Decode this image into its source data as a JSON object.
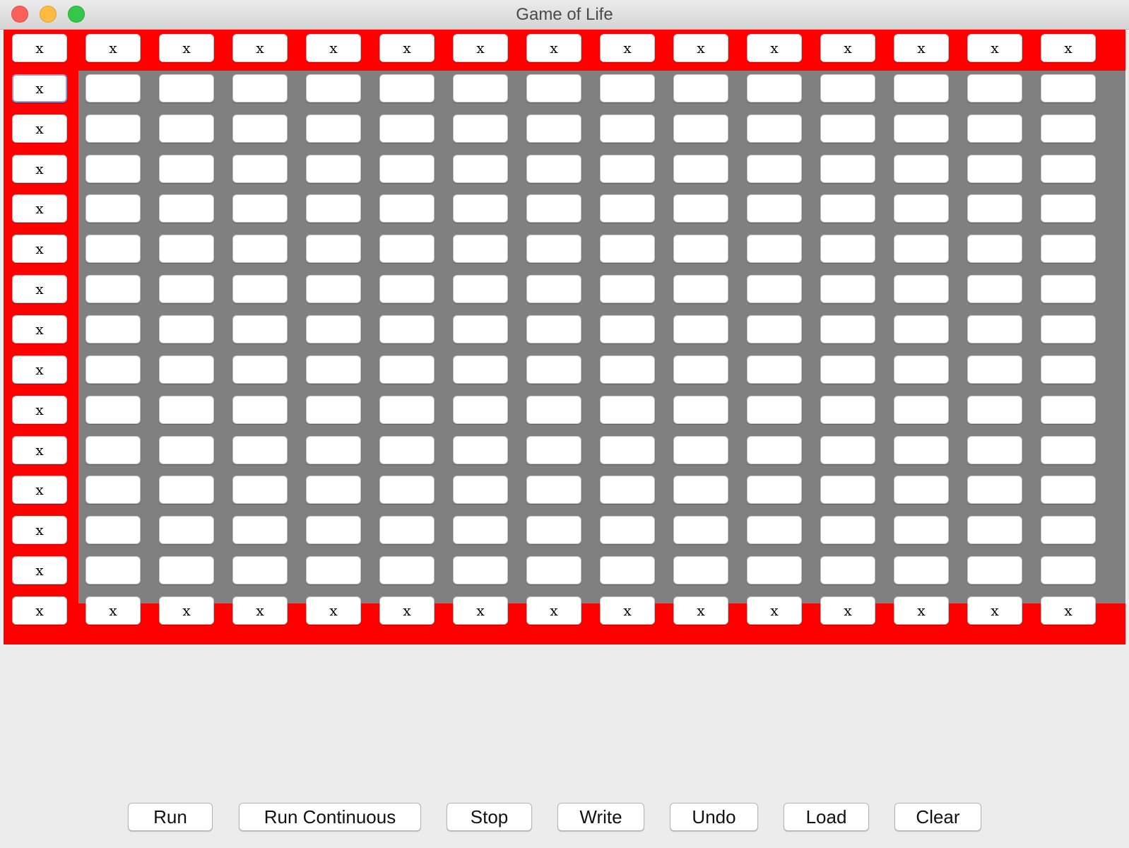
{
  "window": {
    "title": "Game of Life"
  },
  "grid": {
    "rows": 15,
    "cols": 15,
    "border_label": "x",
    "focused_cell": [
      1,
      0
    ],
    "colors": {
      "border": "#ff0000",
      "interior": "#808080",
      "cell": "#ffffff"
    }
  },
  "toolbar": {
    "run_label": "Run",
    "run_continuous_label": "Run Continuous",
    "stop_label": "Stop",
    "write_label": "Write",
    "undo_label": "Undo",
    "load_label": "Load",
    "clear_label": "Clear"
  }
}
